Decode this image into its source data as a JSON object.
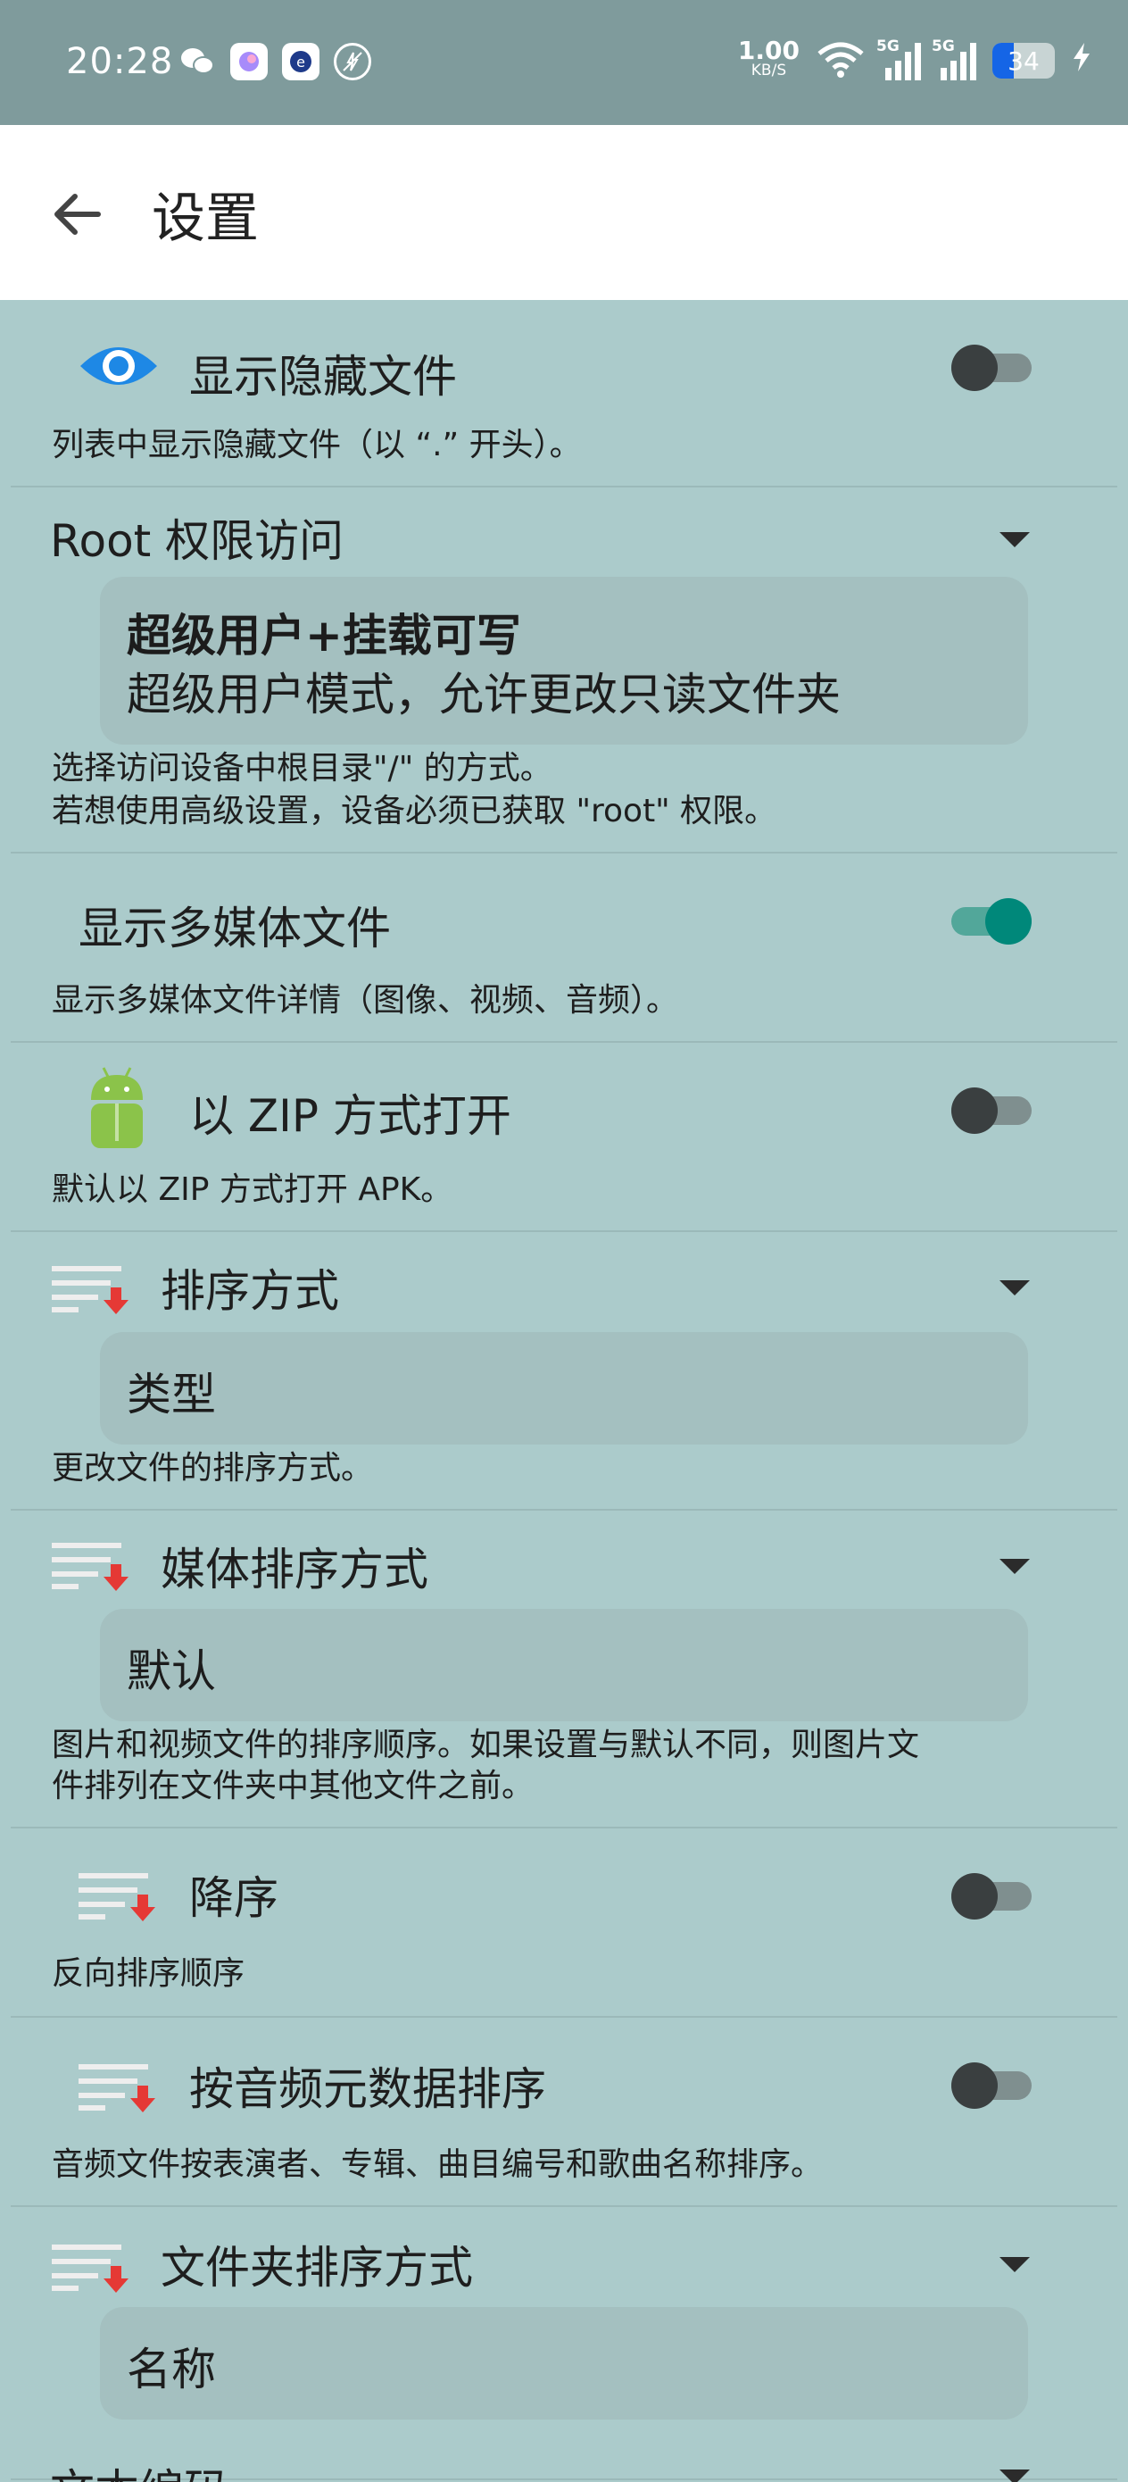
{
  "status_bar": {
    "time": "20:28",
    "speed_value": "1.00",
    "speed_unit": "KB/S",
    "signal1_label": "5G",
    "signal2_label": "5G",
    "battery": "34",
    "icons": [
      "wechat-icon",
      "app-icon",
      "app-icon",
      "vpn-off-icon",
      "wifi-icon",
      "signal-icon",
      "battery-icon",
      "charging-icon"
    ]
  },
  "appbar": {
    "title": "设置"
  },
  "settings": {
    "hidden_files": {
      "title": "显示隐藏文件",
      "summary": "列表中显示隐藏文件（以 “.” 开头）。",
      "enabled": false
    },
    "root_access": {
      "title": "Root 权限访问",
      "value_title": "超级用户+挂载可写",
      "value_desc": "超级用户模式，允许更改只读文件夹",
      "summary_line1": "选择访问设备中根目录\"/\" 的方式。",
      "summary_line2": "若想使用高级设置，设备必须已获取 \"root\" 权限。"
    },
    "media_files": {
      "title": "显示多媒体文件",
      "summary": "显示多媒体文件详情（图像、视频、音频）。",
      "enabled": true
    },
    "zip_open": {
      "title": "以 ZIP 方式打开",
      "summary": "默认以 ZIP 方式打开 APK。",
      "enabled": false
    },
    "sort_method": {
      "title": "排序方式",
      "value": "类型",
      "summary": "更改文件的排序方式。"
    },
    "media_sort": {
      "title": "媒体排序方式",
      "value": "默认",
      "summary_line1": "图片和视频文件的排序顺序。如果设置与默认不同，则图片文",
      "summary_line2": "件排列在文件夹中其他文件之前。"
    },
    "descending": {
      "title": "降序",
      "summary": "反向排序顺序",
      "enabled": false
    },
    "audio_meta_sort": {
      "title": "按音频元数据排序",
      "summary": "音频文件按表演者、专辑、曲目编号和歌曲名称排序。",
      "enabled": false
    },
    "folder_sort": {
      "title": "文件夹排序方式",
      "value": "名称"
    },
    "text_encoding": {
      "title": "文本编码"
    }
  },
  "colors": {
    "background": "#abcbcb",
    "status_bar": "#7f9b9c",
    "accent": "#00887a",
    "value_box": "#a4c0c0"
  }
}
